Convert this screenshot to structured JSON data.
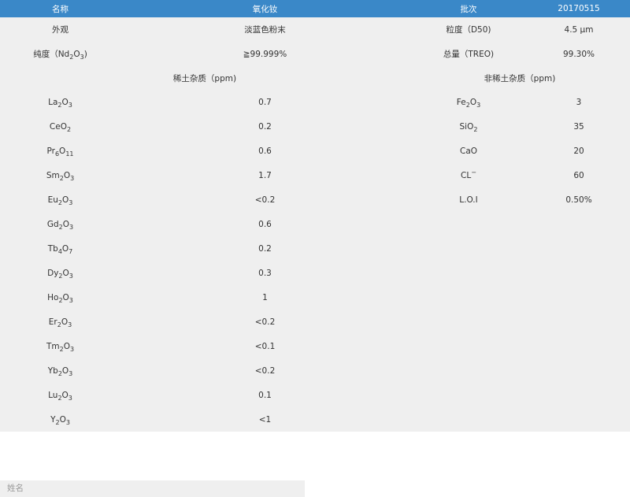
{
  "header": {
    "name": "名称",
    "product": "氧化钕",
    "batch_label": "批次",
    "batch_value": "20170515"
  },
  "appearance": {
    "label": "外观",
    "value": "淡蓝色粉末"
  },
  "granularity": {
    "label": "粒度（D50)",
    "value": "4.5 μm"
  },
  "purity": {
    "label_pre": "纯度（Nd",
    "label_sub1": "2",
    "label_mid": "O",
    "label_sub2": "3",
    "label_post": ")",
    "value": "≧99.999%"
  },
  "treo": {
    "label": "总量（TREO)",
    "value": "99.30%"
  },
  "section_titles": {
    "rare_earth": "稀土杂质（ppm)",
    "non_rare_earth": "非稀土杂质（ppm)"
  },
  "re_impurities": [
    {
      "a": "La",
      "n1": "2",
      "b": "O",
      "n2": "3",
      "value": "0.7"
    },
    {
      "a": "CeO",
      "n1": "2",
      "b": "",
      "n2": "",
      "value": "0.2"
    },
    {
      "a": "Pr",
      "n1": "6",
      "b": "O",
      "n2": "11",
      "value": "0.6"
    },
    {
      "a": "Sm",
      "n1": "2",
      "b": "O",
      "n2": "3",
      "value": "1.7"
    },
    {
      "a": "Eu",
      "n1": "2",
      "b": "O",
      "n2": "3",
      "value": "<0.2"
    },
    {
      "a": "Gd",
      "n1": "2",
      "b": "O",
      "n2": "3",
      "value": "0.6"
    },
    {
      "a": "Tb",
      "n1": "4",
      "b": "O",
      "n2": "7",
      "value": "0.2"
    },
    {
      "a": "Dy",
      "n1": "2",
      "b": "O",
      "n2": "3",
      "value": "0.3"
    },
    {
      "a": "Ho",
      "n1": "2",
      "b": "O",
      "n2": "3",
      "value": "1"
    },
    {
      "a": "Er",
      "n1": "2",
      "b": "O",
      "n2": "3",
      "value": "<0.2"
    },
    {
      "a": "Tm",
      "n1": "2",
      "b": "O",
      "n2": "3",
      "value": "<0.1"
    },
    {
      "a": "Yb",
      "n1": "2",
      "b": "O",
      "n2": "3",
      "value": "<0.2"
    },
    {
      "a": "Lu",
      "n1": "2",
      "b": "O",
      "n2": "3",
      "value": "0.1"
    },
    {
      "a": "Y",
      "n1": "2",
      "b": "O",
      "n2": "3",
      "value": "<1"
    }
  ],
  "nre_impurities": [
    {
      "a": "Fe",
      "n1": "2",
      "b": "O",
      "n2": "3",
      "sup": "",
      "value": "3"
    },
    {
      "a": "SiO",
      "n1": "2",
      "b": "",
      "n2": "",
      "sup": "",
      "value": "35"
    },
    {
      "a": "CaO",
      "n1": "",
      "b": "",
      "n2": "",
      "sup": "",
      "value": "20"
    },
    {
      "a": "CL",
      "n1": "",
      "b": "",
      "n2": "",
      "sup": "−",
      "value": "60"
    },
    {
      "a": "L.O.I",
      "n1": "",
      "b": "",
      "n2": "",
      "sup": "",
      "value": "0.50%"
    }
  ],
  "form": {
    "name_placeholder": "姓名"
  },
  "colors": {
    "header_bg": "#3a88c8",
    "table_bg": "#efefef"
  }
}
